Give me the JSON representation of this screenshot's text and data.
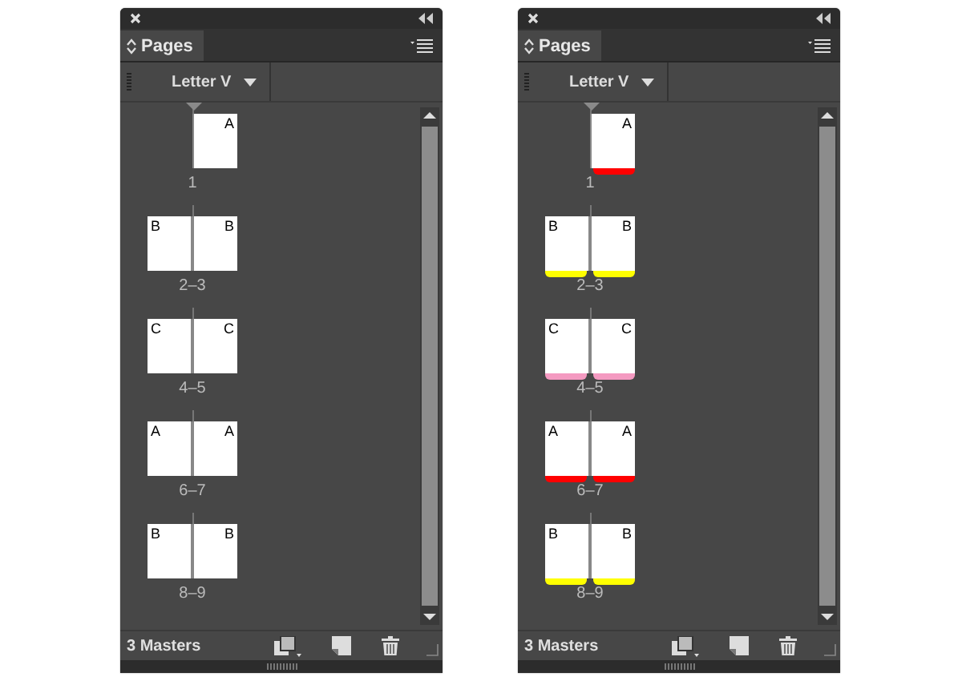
{
  "panels": [
    {
      "tab": "Pages",
      "dropdown": "Letter V",
      "spreads": [
        {
          "pages": [
            {
              "master": "A"
            }
          ],
          "label": "1"
        },
        {
          "pages": [
            {
              "master": "B"
            },
            {
              "master": "B"
            }
          ],
          "label": "2–3"
        },
        {
          "pages": [
            {
              "master": "C"
            },
            {
              "master": "C"
            }
          ],
          "label": "4–5"
        },
        {
          "pages": [
            {
              "master": "A"
            },
            {
              "master": "A"
            }
          ],
          "label": "6–7"
        },
        {
          "pages": [
            {
              "master": "B"
            },
            {
              "master": "B"
            }
          ],
          "label": "8–9"
        }
      ],
      "footer": "3 Masters"
    },
    {
      "tab": "Pages",
      "dropdown": "Letter V",
      "spreads": [
        {
          "pages": [
            {
              "master": "A",
              "color": "#ff0000"
            }
          ],
          "label": "1"
        },
        {
          "pages": [
            {
              "master": "B",
              "color": "#ffff00"
            },
            {
              "master": "B",
              "color": "#ffff00"
            }
          ],
          "label": "2–3"
        },
        {
          "pages": [
            {
              "master": "C",
              "color": "#f49ac1"
            },
            {
              "master": "C",
              "color": "#f49ac1"
            }
          ],
          "label": "4–5"
        },
        {
          "pages": [
            {
              "master": "A",
              "color": "#ff0000"
            },
            {
              "master": "A",
              "color": "#ff0000"
            }
          ],
          "label": "6–7"
        },
        {
          "pages": [
            {
              "master": "B",
              "color": "#ffff00"
            },
            {
              "master": "B",
              "color": "#ffff00"
            }
          ],
          "label": "8–9"
        }
      ],
      "footer": "3 Masters"
    }
  ]
}
